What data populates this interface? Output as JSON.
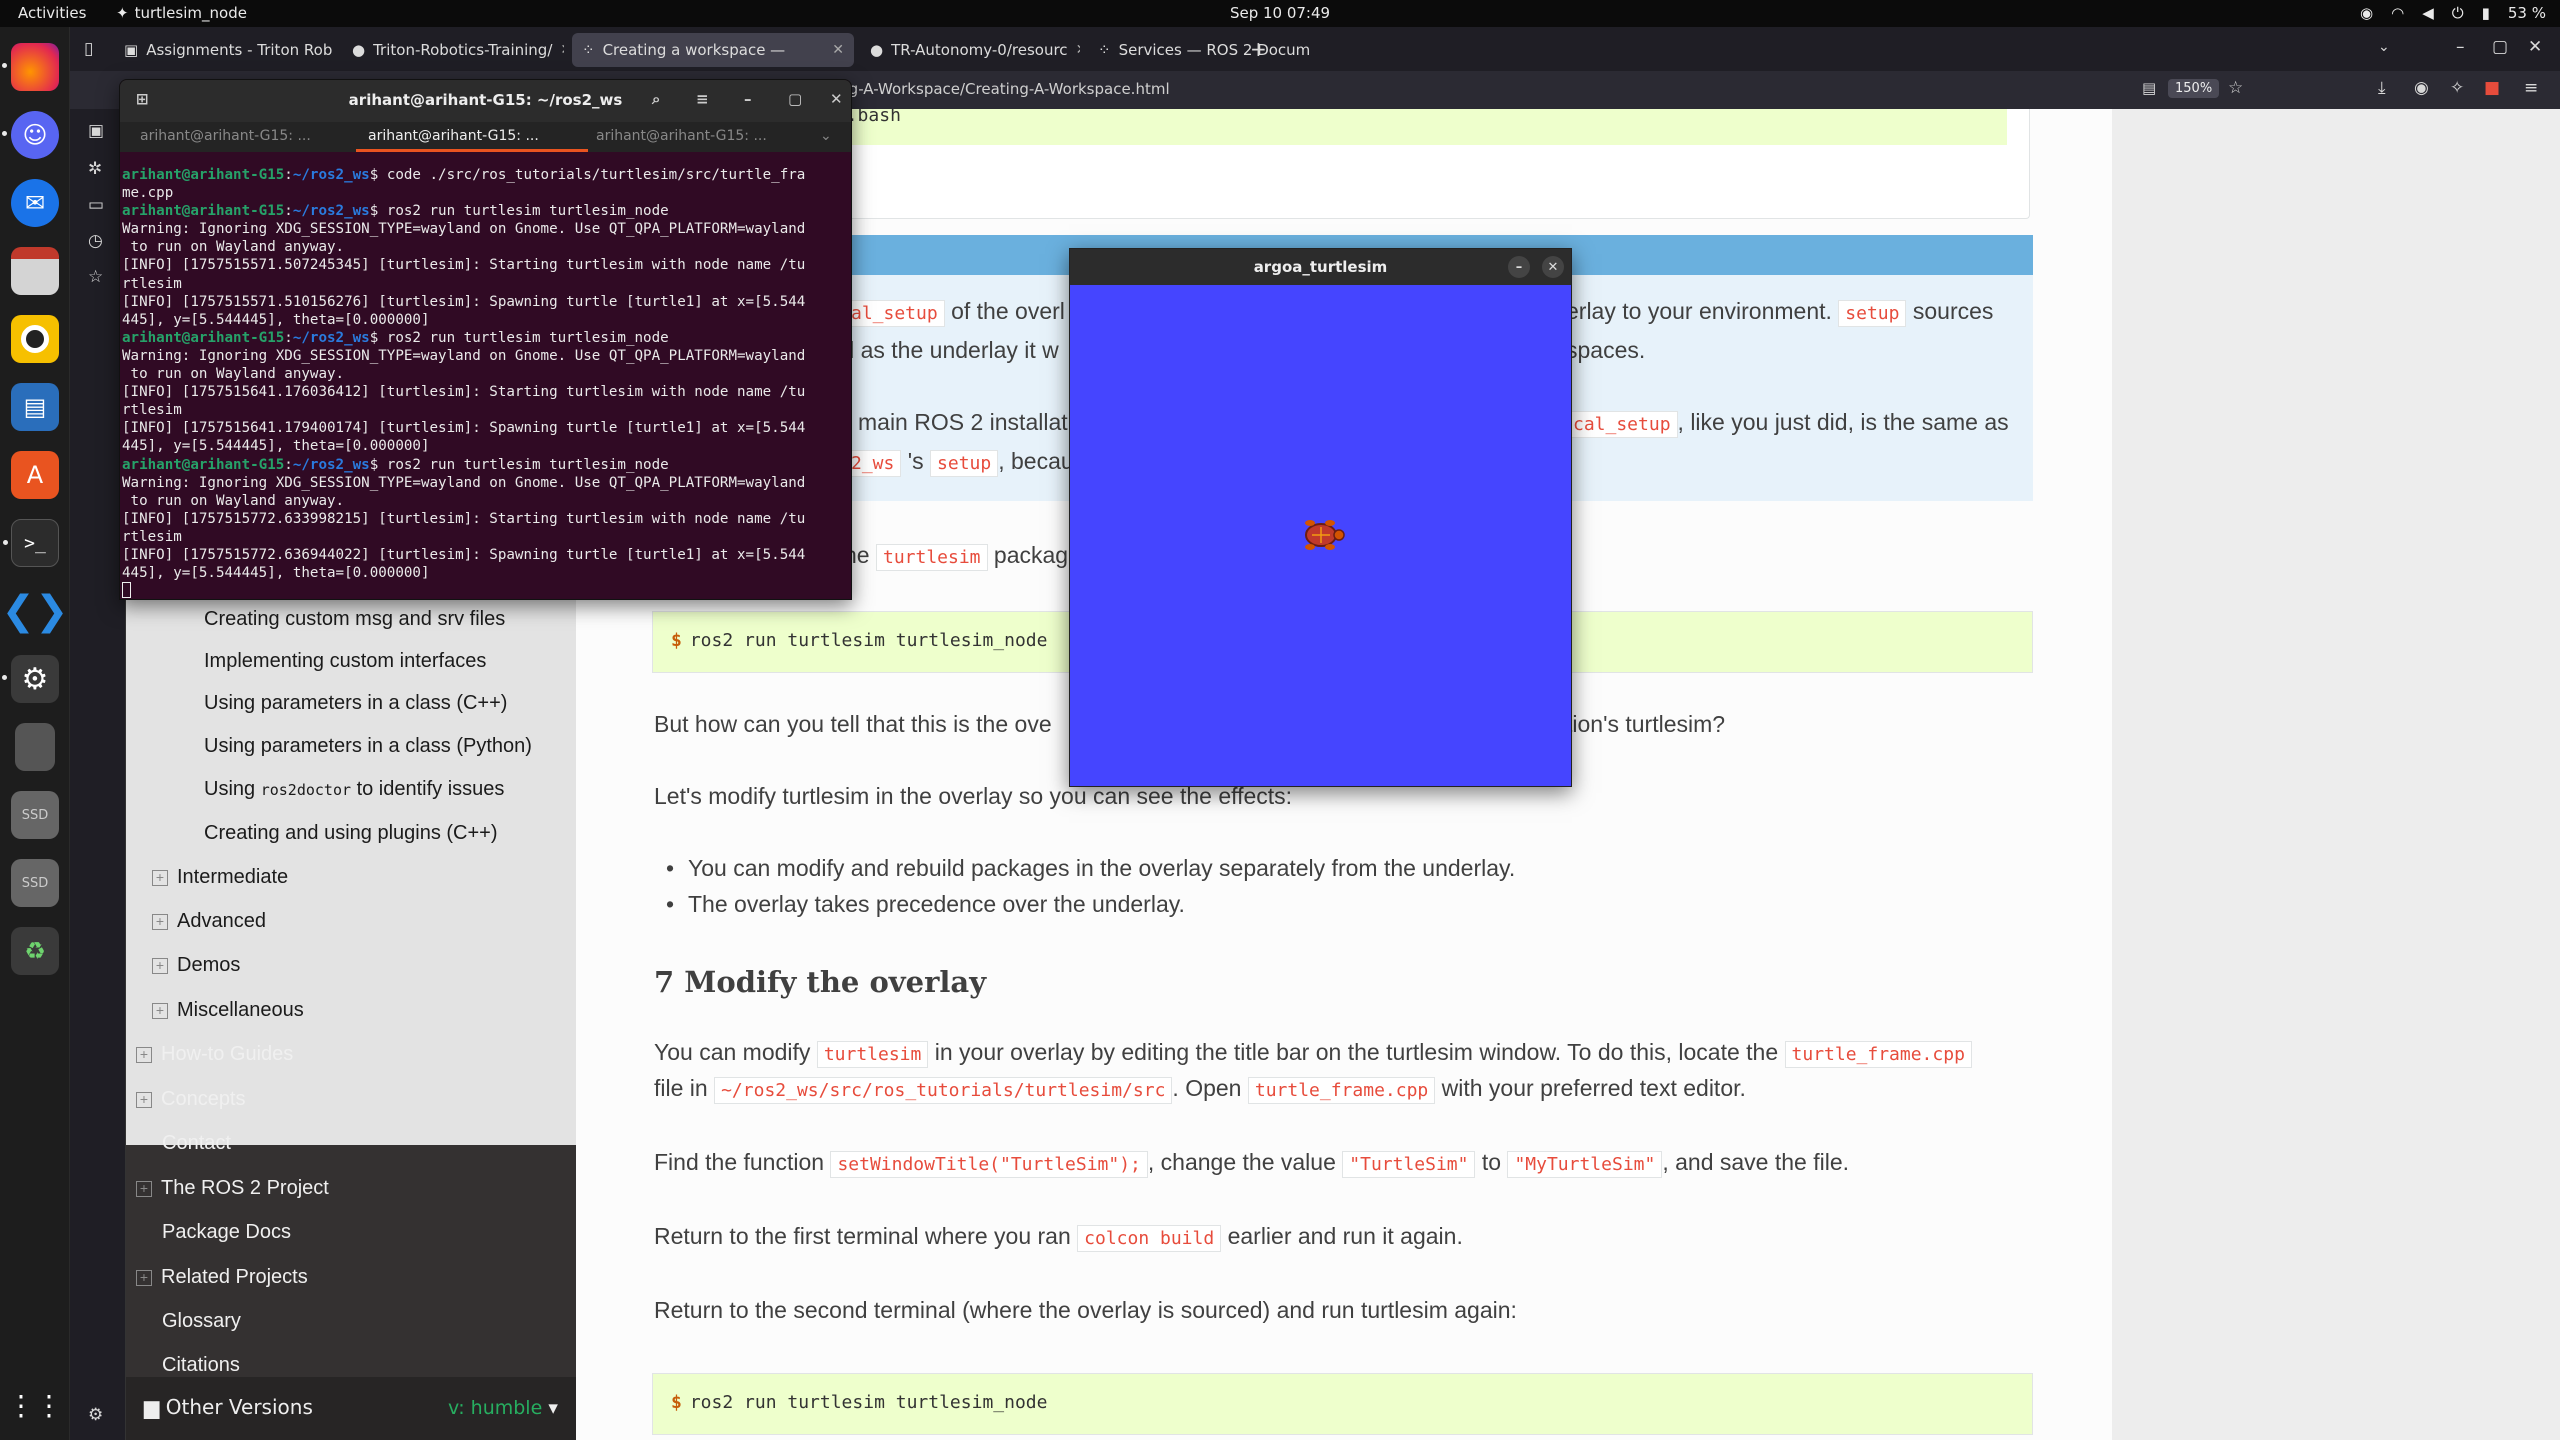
{
  "topbar": {
    "activities": "Activities",
    "app_name": "turtlesim_node",
    "clock": "Sep 10  07:49",
    "battery": "53 %"
  },
  "browser": {
    "tabs": [
      {
        "label": "Assignments - Triton Rob"
      },
      {
        "label": "Triton-Robotics-Training/"
      },
      {
        "label": "Creating a workspace —"
      },
      {
        "label": "TR-Autonomy-0/resourc"
      },
      {
        "label": "Services — ROS 2 Docum"
      }
    ],
    "url": "ing-A-Workspace/Creating-A-Workspace.html",
    "zoom": "150%"
  },
  "nav": {
    "sub_items": [
      "Creating custom msg and srv files",
      "Implementing custom interfaces",
      "Using parameters in a class (C++)",
      "Using parameters in a class (Python)"
    ],
    "doctor_pre": "Using ",
    "doctor_code": "ros2doctor",
    "doctor_post": " to identify issues",
    "plugins": "Creating and using plugins (C++)",
    "groups": [
      "Intermediate",
      "Advanced",
      "Demos",
      "Miscellaneous"
    ],
    "top_items": [
      "How-to Guides",
      "Concepts",
      "Contact",
      "The ROS 2 Project",
      "Package Docs",
      "Related Projects",
      "Glossary",
      "Citations"
    ],
    "expandable": [
      true,
      true,
      false,
      true,
      false,
      true,
      false,
      false
    ],
    "versions_label": "Other Versions",
    "versions_value": "v: humble"
  },
  "content": {
    "prev_code": "ll/local_setup.bash",
    "note_line1_a": "al_setup",
    "note_line1_b": " of the overl",
    "note_line1_c": "erlay to your environment. ",
    "note_line1_d": "setup",
    "note_line1_e": " sources",
    "note_line2_a": "ll as the underlay it w",
    "note_line2_b": "spaces.",
    "note_line3_a": "main ROS 2 installat",
    "note_line3_b": "cal_setup",
    "note_line3_c": ", like you just did, is the same as",
    "note_line4_a": "2_ws",
    "note_line4_b": " 's ",
    "note_line4_c": "setup",
    "note_line4_d": ", becau",
    "note_line4_e": ".",
    "run_pre": "he ",
    "run_code": "turtlesim",
    "run_post": " packag",
    "code1": "ros2 run turtlesim turtlesim_node",
    "prompt": "$",
    "p_how_a": "But how can you tell that this is the ove",
    "p_how_b": "tion's turtlesim?",
    "p_modify": "Let's modify turtlesim in the overlay so you can see the effects:",
    "bullets": [
      "You can modify and rebuild packages in the overlay separately from the underlay.",
      "The overlay takes precedence over the underlay."
    ],
    "section_title": "7 Modify the overlay",
    "p1_a": "You can modify ",
    "p1_code": "turtlesim",
    "p1_b": " in your overlay by editing the title bar on the turtlesim window. To do this, locate the ",
    "p1_code2": "turtle_frame.cpp",
    "p2_a": "file in ",
    "p2_code": "~/ros2_ws/src/ros_tutorials/turtlesim/src",
    "p2_b": ". Open ",
    "p2_code2": "turtle_frame.cpp",
    "p2_c": " with your preferred text editor.",
    "p3_a": "Find the function ",
    "p3_code": "setWindowTitle(\"TurtleSim\");",
    "p3_b": ", change the value ",
    "p3_code2": "\"TurtleSim\"",
    "p3_c": " to ",
    "p3_code3": "\"MyTurtleSim\"",
    "p3_d": ", and save the file.",
    "p4_a": "Return to the first terminal where you ran ",
    "p4_code": "colcon build",
    "p4_b": " earlier and run it again.",
    "p5": "Return to the second terminal (where the overlay is sourced) and run turtlesim again:",
    "code2": "ros2 run turtlesim turtlesim_node"
  },
  "terminal": {
    "title": "arihant@arihant-G15: ~/ros2_ws",
    "tabs": [
      "arihant@arihant-G15: ...",
      "arihant@arihant-G15: ...",
      "arihant@arihant-G15: ..."
    ],
    "user": "arihant@arihant-G15",
    "path": "~/ros2_ws",
    "cmd1": "code ./src/ros_tutorials/turtlesim/src/turtle_fra\nme.cpp",
    "cmd2": "ros2 run turtlesim turtlesim_node",
    "out1": "Warning: Ignoring XDG_SESSION_TYPE=wayland on Gnome. Use QT_QPA_PLATFORM=wayland\n to run on Wayland anyway.\n[INFO] [1757515571.507245345] [turtlesim]: Starting turtlesim with node name /tu\nrtlesim\n[INFO] [1757515571.510156276] [turtlesim]: Spawning turtle [turtle1] at x=[5.544\n445], y=[5.544445], theta=[0.000000]",
    "out2": "Warning: Ignoring XDG_SESSION_TYPE=wayland on Gnome. Use QT_QPA_PLATFORM=wayland\n to run on Wayland anyway.\n[INFO] [1757515641.176036412] [turtlesim]: Starting turtlesim with node name /tu\nrtlesim\n[INFO] [1757515641.179400174] [turtlesim]: Spawning turtle [turtle1] at x=[5.544\n445], y=[5.544445], theta=[0.000000]",
    "out3": "Warning: Ignoring XDG_SESSION_TYPE=wayland on Gnome. Use QT_QPA_PLATFORM=wayland\n to run on Wayland anyway.\n[INFO] [1757515772.633998215] [turtlesim]: Starting turtlesim with node name /tu\nrtlesim\n[INFO] [1757515772.636944022] [turtlesim]: Spawning turtle [turtle1] at x=[5.544\n445], y=[5.544445], theta=[0.000000]"
  },
  "turtlesim": {
    "title": "argoa_turtlesim",
    "background": "#4545ff"
  }
}
